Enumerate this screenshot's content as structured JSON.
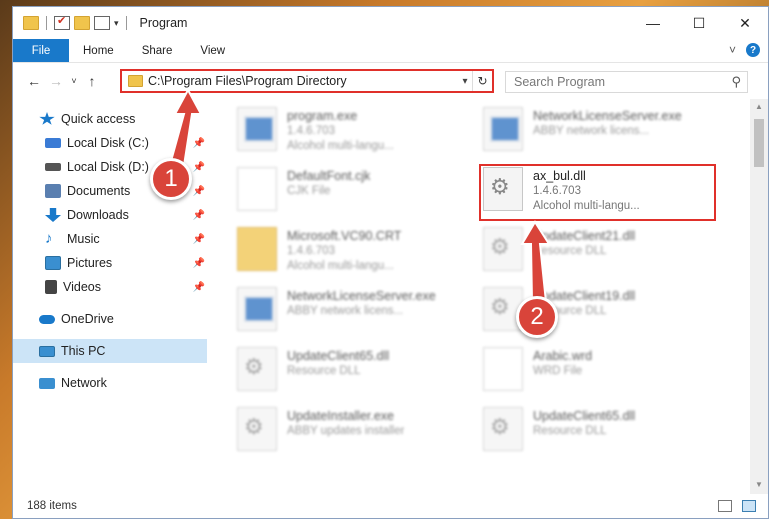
{
  "window": {
    "title": "Program",
    "controls": [
      "—",
      "☐",
      "✕"
    ]
  },
  "ribbon": {
    "tabs": [
      "File",
      "Home",
      "Share",
      "View"
    ],
    "expand_glyph": "˅",
    "help_glyph": "?"
  },
  "nav": {
    "back": "←",
    "forward": "→",
    "recent": "˅",
    "up": "↑",
    "address": "C:\\Program Files\\Program Directory",
    "search_placeholder": "Search Program"
  },
  "sidebar": {
    "items": [
      {
        "label": "Quick access",
        "icon": "star-icon",
        "color": "#1979ca"
      },
      {
        "label": "Local Disk (C:)",
        "icon": "drive-icon",
        "color": "#3a7bd5"
      },
      {
        "label": "Local Disk (D:)",
        "icon": "drive-icon",
        "color": "#555555"
      },
      {
        "label": "Documents",
        "icon": "documents-icon",
        "color": "#5a7fb0"
      },
      {
        "label": "Downloads",
        "icon": "downloads-icon",
        "color": "#1979ca"
      },
      {
        "label": "Music",
        "icon": "music-icon",
        "color": "#1979ca"
      },
      {
        "label": "Pictures",
        "icon": "pictures-icon",
        "color": "#3a8fd0"
      },
      {
        "label": "Videos",
        "icon": "videos-icon",
        "color": "#444444"
      },
      {
        "label": "OneDrive",
        "icon": "cloud-icon",
        "color": "#1979ca"
      },
      {
        "label": "This PC",
        "icon": "computer-icon",
        "color": "#3a8fd0"
      },
      {
        "label": "Network",
        "icon": "network-icon",
        "color": "#3a8fd0"
      }
    ]
  },
  "files": [
    {
      "name": "program.exe",
      "line2": "1.4.6.703",
      "line3": "Alcohol multi-langu...",
      "icon": "exe"
    },
    {
      "name": "NetworkLicenseServer.exe",
      "line2": "ABBY network licens...",
      "line3": "",
      "icon": "exe"
    },
    {
      "name": "DefaultFont.cjk",
      "line2": "CJK File",
      "line3": "",
      "icon": "doc"
    },
    {
      "name": "ax_bul.dll",
      "line2": "1.4.6.703",
      "line3": "Alcohol multi-langu...",
      "icon": "gear"
    },
    {
      "name": "Microsoft.VC90.CRT",
      "line2": "1.4.6.703",
      "line3": "Alcohol multi-langu...",
      "icon": "folder"
    },
    {
      "name": "UpdateClient21.dll",
      "line2": "Resource DLL",
      "line3": "",
      "icon": "gear"
    },
    {
      "name": "NetworkLicenseServer.exe",
      "line2": "ABBY network licens...",
      "line3": "",
      "icon": "exe"
    },
    {
      "name": "UpdateClient19.dll",
      "line2": "Resource DLL",
      "line3": "",
      "icon": "gear"
    },
    {
      "name": "UpdateClient65.dll",
      "line2": "Resource DLL",
      "line3": "",
      "icon": "gear"
    },
    {
      "name": "Arabic.wrd",
      "line2": "WRD File",
      "line3": "",
      "icon": "doc"
    },
    {
      "name": "UpdateInstaller.exe",
      "line2": "ABBY updates installer",
      "line3": "",
      "icon": "gear"
    },
    {
      "name": "UpdateClient65.dll",
      "line2": "Resource DLL",
      "line3": "",
      "icon": "gear"
    }
  ],
  "status": {
    "count": "188 items"
  },
  "annotations": {
    "badge1": "1",
    "badge2": "2",
    "color": "#e0302a"
  }
}
